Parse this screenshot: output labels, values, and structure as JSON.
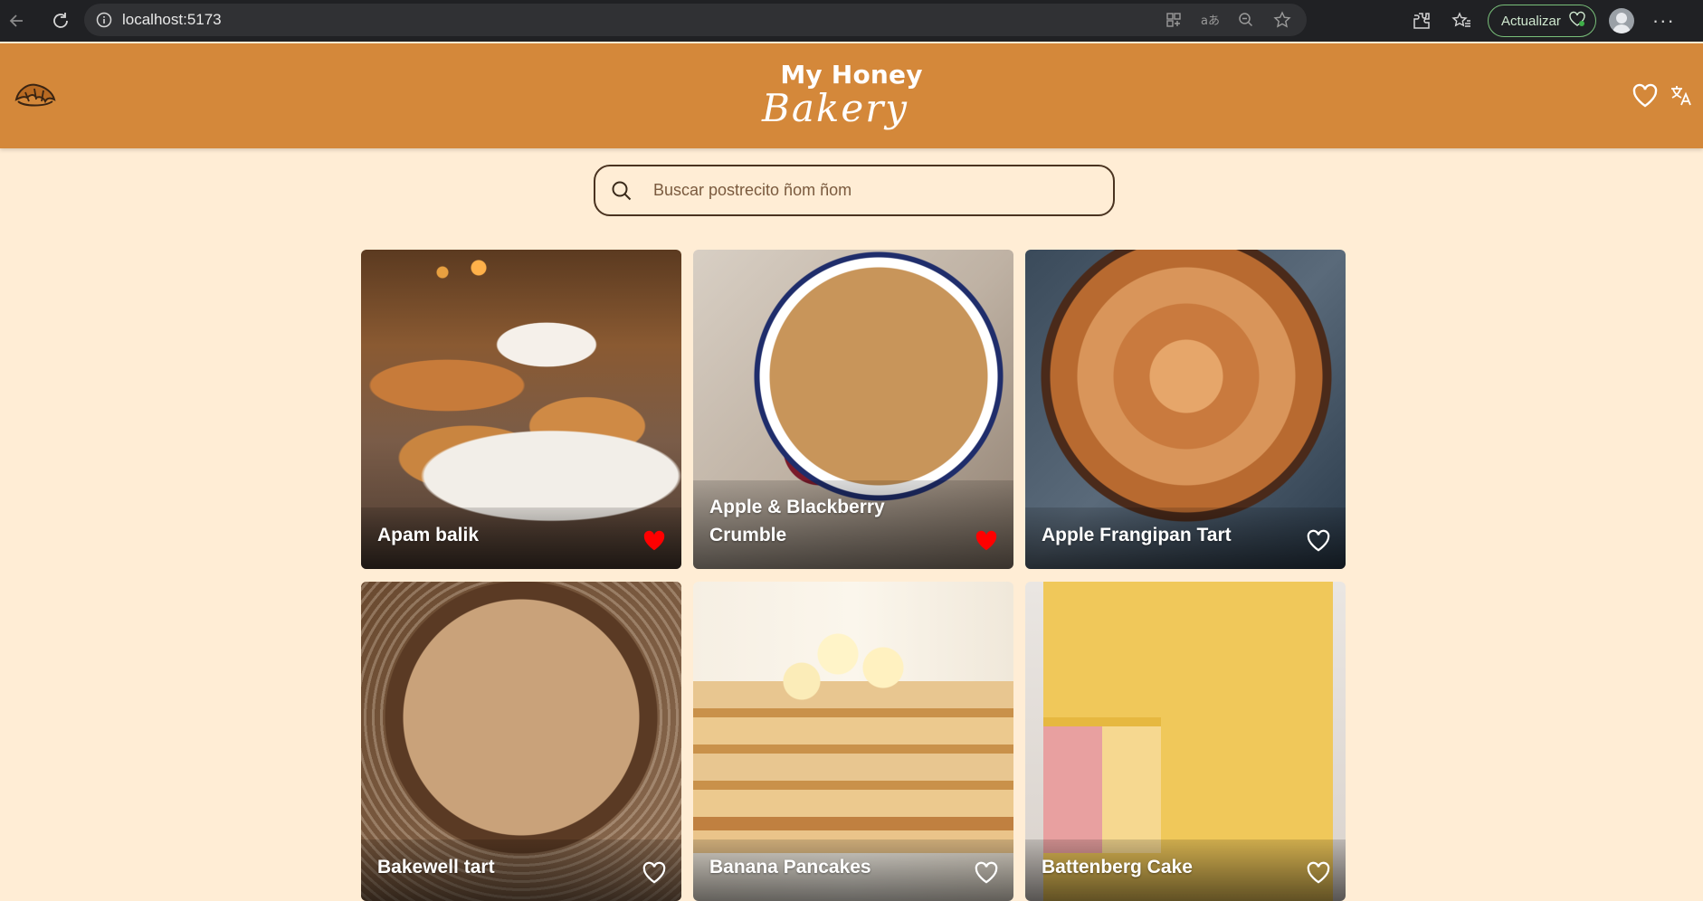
{
  "browser": {
    "url": "localhost:5173",
    "update_label": "Actualizar"
  },
  "header": {
    "brand_line1": "My Honey",
    "brand_line2": "Bakery"
  },
  "search": {
    "placeholder": "Buscar postrecito ñom ñom"
  },
  "colors": {
    "header_bg": "#d4883a",
    "page_bg": "#ffedd5",
    "favorite_active": "#ff0000"
  },
  "desserts": [
    {
      "name": "Apam balik",
      "favorite": true
    },
    {
      "name": "Apple & Blackberry Crumble",
      "favorite": true
    },
    {
      "name": "Apple Frangipan Tart",
      "favorite": false
    },
    {
      "name": "Bakewell tart",
      "favorite": false
    },
    {
      "name": "Banana Pancakes",
      "favorite": false
    },
    {
      "name": "Battenberg Cake",
      "favorite": false
    }
  ]
}
